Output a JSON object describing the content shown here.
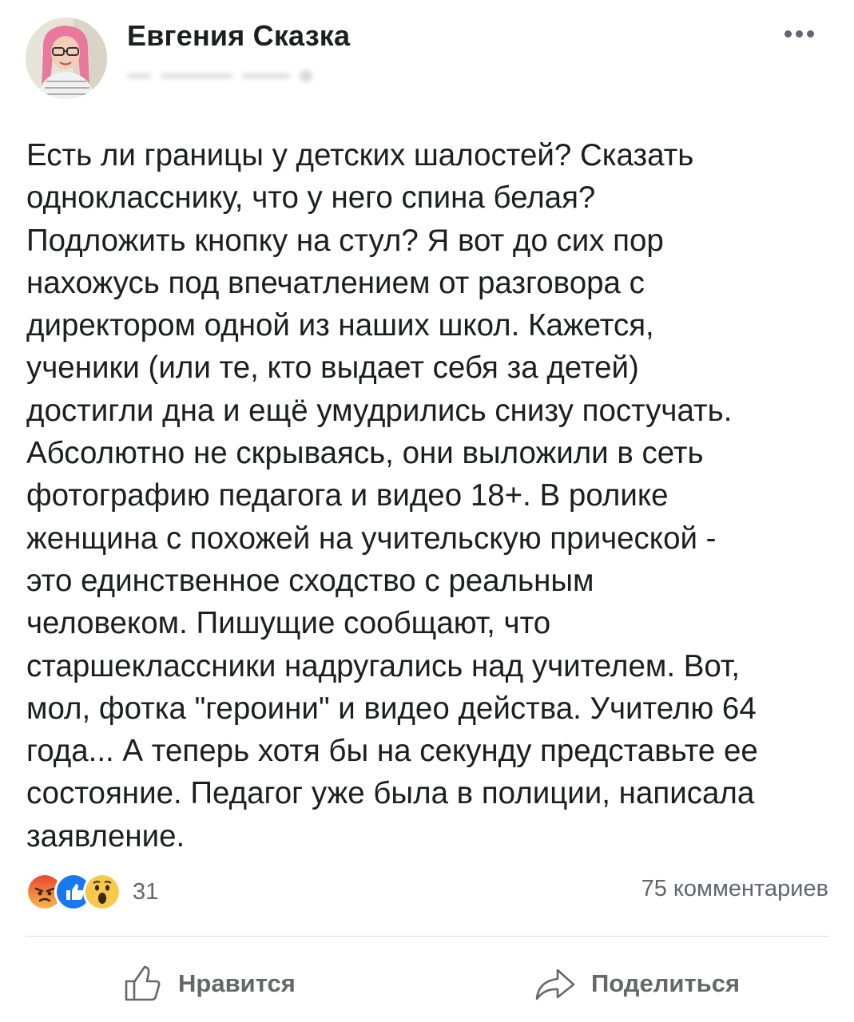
{
  "post": {
    "author": "Евгения Сказка",
    "text_lines": [
      "Есть ли границы у детских шалостей? Сказать",
      "однокласснику, что у него спина белая?",
      "Подложить кнопку на стул? Я вот до сих пор",
      "нахожусь под впечатлением от разговора с",
      "директором одной из наших школ. Кажется,",
      "ученики (или те, кто выдает себя за детей)",
      "достигли дна и ещё умудрились снизу постучать.",
      "Абсолютно не скрываясь, они выложили в сеть",
      "фотографию педагога и видео 18+. В ролике",
      "женщина с похожей на учительскую прической -",
      "это единственное сходство с реальным",
      "человеком. Пишущие сообщают, что",
      "старшеклассники надругались над учителем. Вот,",
      "мол, фотка \"героини\" и видео действа. Учителю 64",
      "года... А теперь хотя бы на секунду представьте ее",
      "состояние. Педагог уже была в полиции, написала",
      "заявление."
    ]
  },
  "reactions": {
    "icons": [
      "angry-icon",
      "like-reaction-icon",
      "wow-icon"
    ],
    "count": "31"
  },
  "comments_label": "75 комментариев",
  "actions": {
    "like_label": "Нравится",
    "share_label": "Поделиться"
  },
  "colors": {
    "text": "#1c1e21",
    "secondary": "#606770",
    "like_blue": "#1877f2",
    "angry": "#f05d2f",
    "wow": "#f7c94a"
  }
}
